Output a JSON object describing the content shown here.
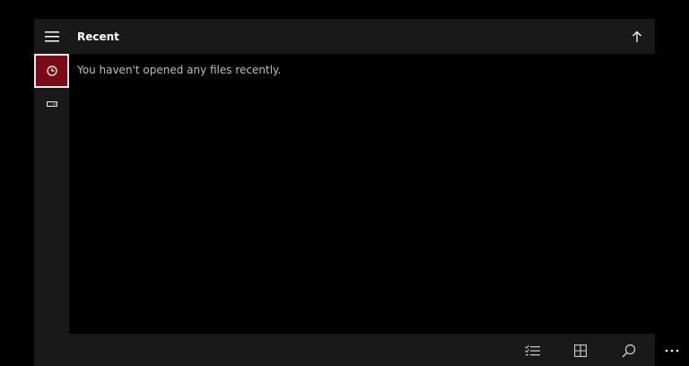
{
  "header": {
    "title": "Recent"
  },
  "main": {
    "empty_message": "You haven't opened any files recently."
  },
  "sidebar": {
    "items": [
      {
        "icon": "hamburger-menu-icon"
      },
      {
        "icon": "clock-icon",
        "selected": true
      },
      {
        "icon": "drive-icon"
      }
    ]
  },
  "bottom_bar": {
    "buttons": [
      {
        "icon": "select-list-icon"
      },
      {
        "icon": "grid-view-icon"
      },
      {
        "icon": "search-icon"
      },
      {
        "icon": "more-icon"
      }
    ]
  },
  "colors": {
    "accent": "#7a0c15",
    "bar_bg": "#191919",
    "background": "#000000",
    "text": "#ffffff",
    "muted_text": "#bdbdbd"
  }
}
